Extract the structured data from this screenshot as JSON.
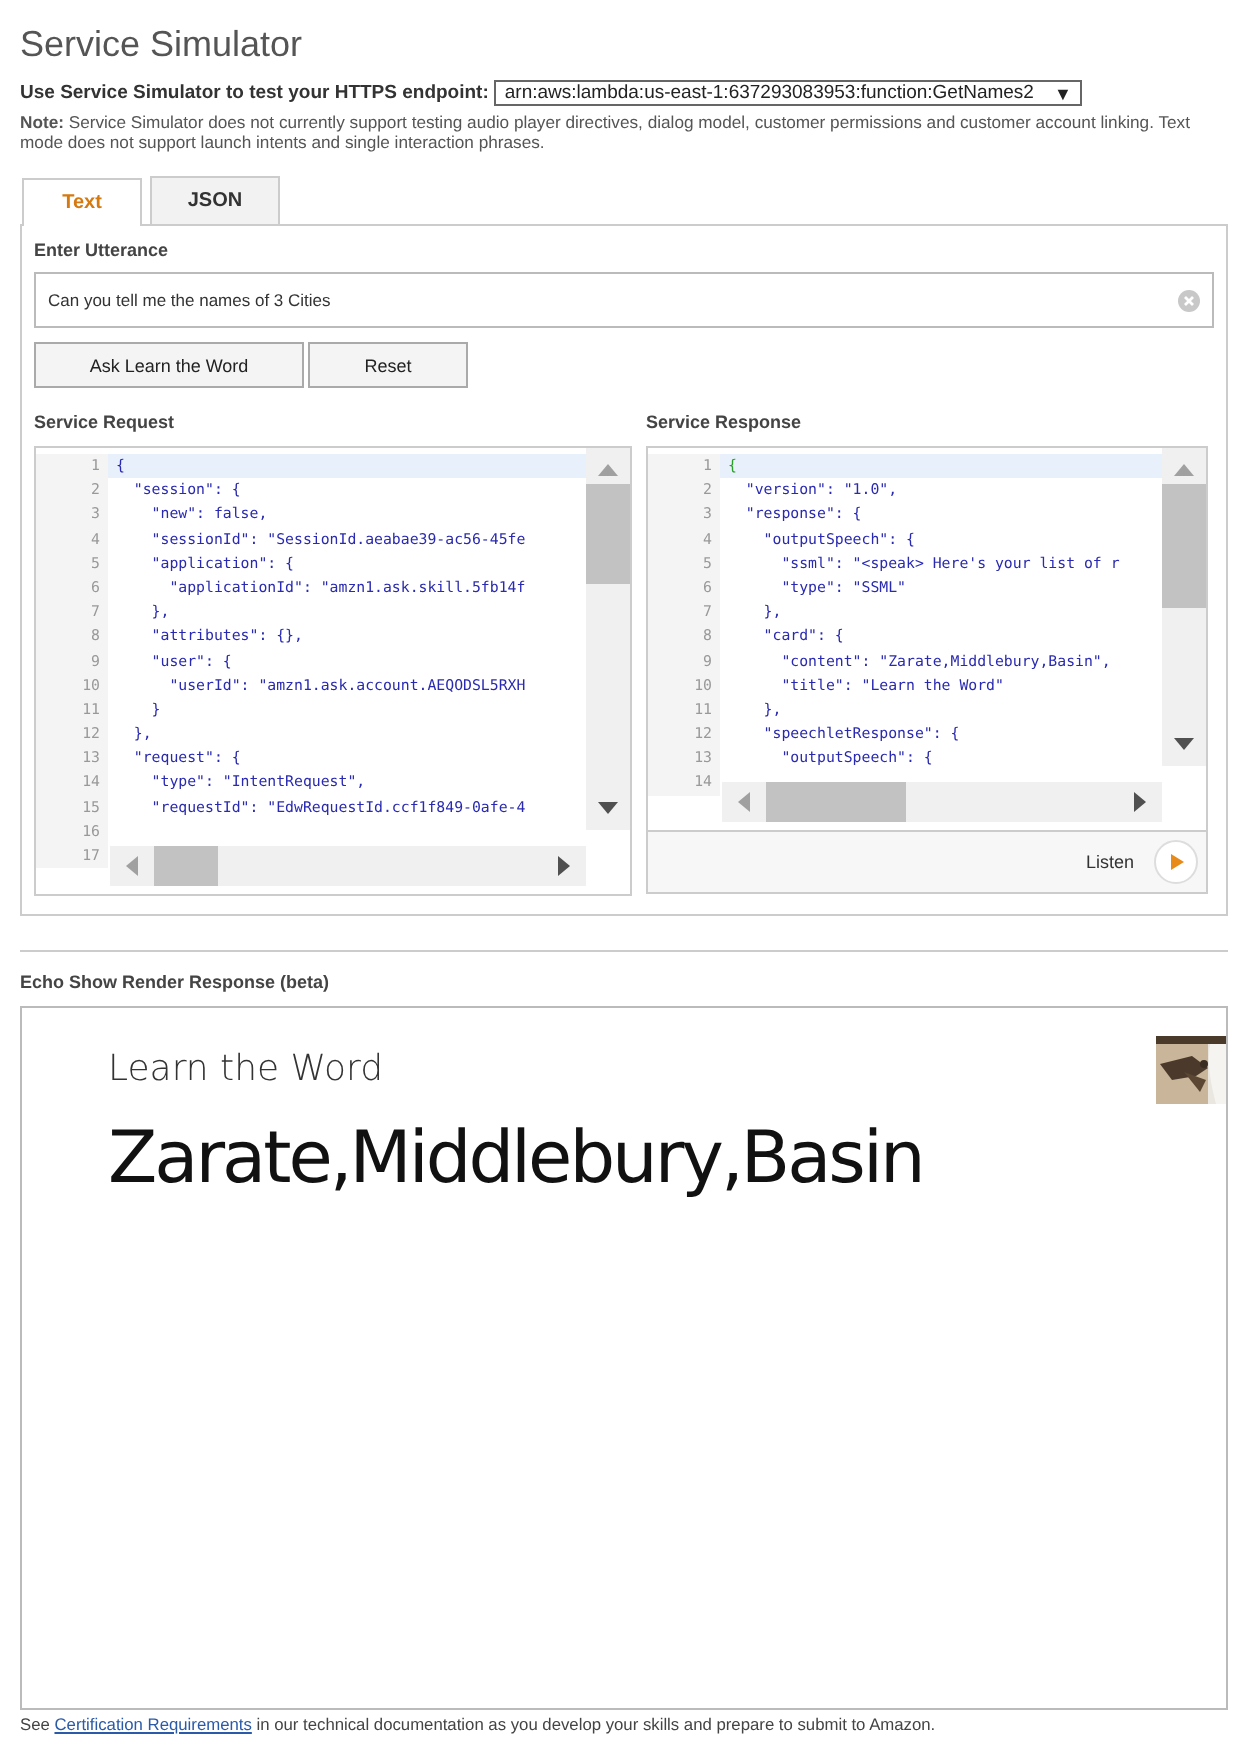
{
  "page_title": "Service Simulator",
  "endpoint": {
    "label": "Use Service Simulator to test your HTTPS endpoint:",
    "value": "arn:aws:lambda:us-east-1:637293083953:function:GetNames2",
    "caret": "▼"
  },
  "note": "**Note:** Service Simulator does not currently support testing audio player directives, dialog model, customer permissions and customer account linking. Text mode does not support launch intents and single interaction phrases.",
  "tabs": [
    {
      "label": "Text",
      "selected": true
    },
    {
      "label": "JSON",
      "selected": false
    }
  ],
  "utterance": {
    "label": "Enter Utterance",
    "value": "Can you tell me the names of 3 Cities"
  },
  "buttons": [
    "Ask Learn the Word",
    "Reset"
  ],
  "editors": [
    {
      "title": "Service Request",
      "lines": [
        {
          "num": "1",
          "code": "{"
        },
        {
          "num": "2",
          "code": "  \"session\": {"
        },
        {
          "num": "3",
          "code": "    \"new\": false,"
        },
        {
          "num": "4",
          "code": "    \"sessionId\": \"SessionId.aeabae39-ac56-45fe"
        },
        {
          "num": "5",
          "code": "    \"application\": {"
        },
        {
          "num": "6",
          "code": "      \"applicationId\": \"amzn1.ask.skill.5fb14f"
        },
        {
          "num": "7",
          "code": "    },"
        },
        {
          "num": "8",
          "code": "    \"attributes\": {},"
        },
        {
          "num": "9",
          "code": "    \"user\": {"
        },
        {
          "num": "10",
          "code": "      \"userId\": \"amzn1.ask.account.AEQODSL5RXH"
        },
        {
          "num": "11",
          "code": "    }"
        },
        {
          "num": "12",
          "code": "  },"
        },
        {
          "num": "13",
          "code": "  \"request\": {"
        },
        {
          "num": "14",
          "code": "    \"type\": \"IntentRequest\","
        },
        {
          "num": "15",
          "code": "    \"requestId\": \"EdwRequestId.ccf1f849-0afe-4"
        },
        {
          "num": "16"
        },
        {
          "num": "17"
        }
      ]
    },
    {
      "title": "Service Response",
      "listen": "Listen",
      "lines": [
        {
          "num": "1",
          "code": "{"
        },
        {
          "num": "2",
          "code": "  \"version\": \"1.0\","
        },
        {
          "num": "3",
          "code": "  \"response\": {"
        },
        {
          "num": "4",
          "code": "    \"outputSpeech\": {"
        },
        {
          "num": "5",
          "code": "      \"ssml\": \"<speak> Here's your list of r"
        },
        {
          "num": "6",
          "code": "      \"type\": \"SSML\""
        },
        {
          "num": "7",
          "code": "    },"
        },
        {
          "num": "8",
          "code": "    \"card\": {"
        },
        {
          "num": "9",
          "code": "      \"content\": \"Zarate,Middlebury,Basin\","
        },
        {
          "num": "10",
          "code": "      \"title\": \"Learn the Word\""
        },
        {
          "num": "11",
          "code": "    },"
        },
        {
          "num": "12",
          "code": "    \"speechletResponse\": {"
        },
        {
          "num": "13",
          "code": "      \"outputSpeech\": {"
        },
        {
          "num": "14"
        }
      ]
    }
  ],
  "render": {
    "label": "Echo Show Render Response (beta)",
    "title": "Learn the Word",
    "content": "Zarate,Middlebury,Basin"
  },
  "footer": {
    "before": "See",
    "link": "Certification Requirements",
    "after": "in our technical documentation as you develop your skills and prepare to submit to Amazon."
  }
}
